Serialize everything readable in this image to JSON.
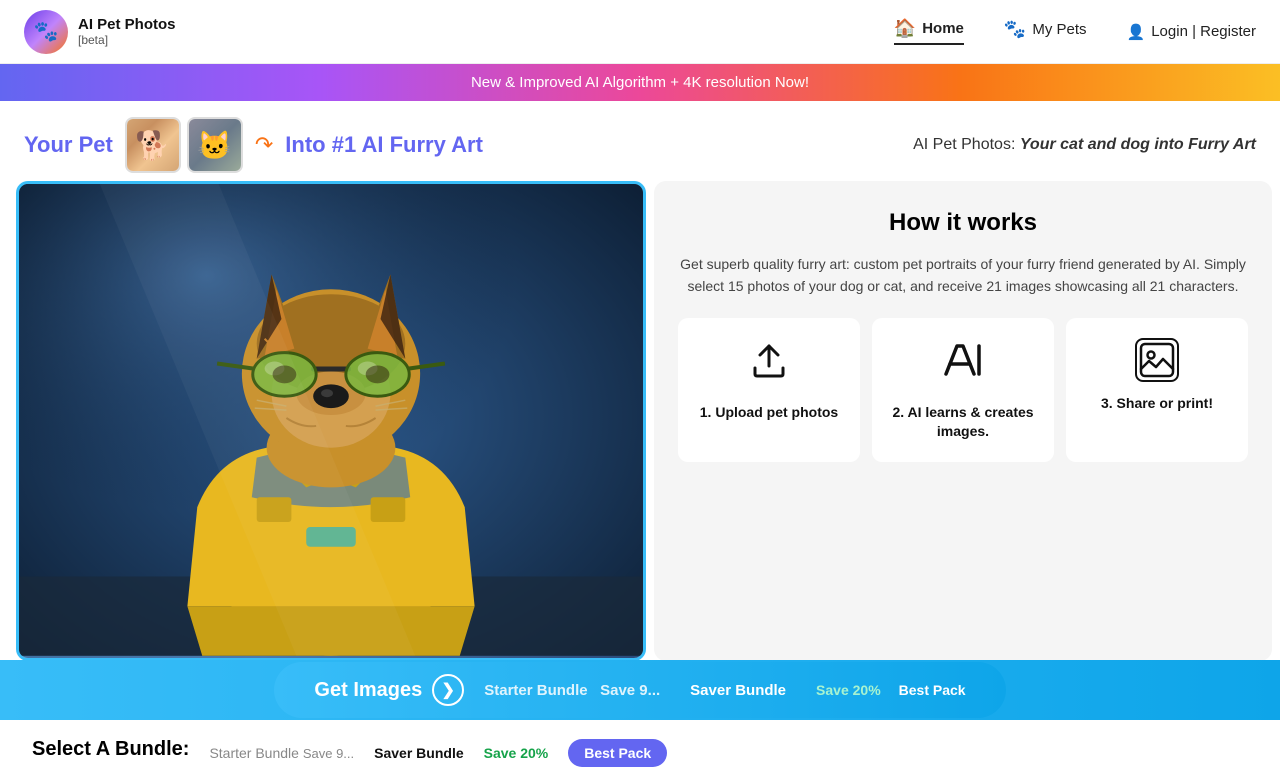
{
  "header": {
    "logo_title": "AI Pet Photos",
    "logo_beta": "[beta]",
    "logo_emoji": "🐾",
    "nav": [
      {
        "id": "home",
        "label": "Home",
        "active": true,
        "icon": "🏠"
      },
      {
        "id": "my-pets",
        "label": "My Pets",
        "active": false,
        "icon": "🐾"
      }
    ],
    "login_label": "Login | Register",
    "login_icon": "👤"
  },
  "banner": {
    "text": "New & Improved AI Algorithm + 4K resolution Now!"
  },
  "hero": {
    "your_pet_label": "Your Pet",
    "arrow": "↷",
    "into_label": "Into #1 AI Furry Art",
    "right_title": "AI Pet Photos:",
    "right_subtitle": "Your cat and dog into Furry Art"
  },
  "how_it_works": {
    "title": "How it works",
    "description": "Get superb quality furry art: custom pet portraits of your furry friend generated by AI. Simply select 15 photos of your dog or cat, and receive 21 images showcasing all 21 characters.",
    "steps": [
      {
        "id": "upload",
        "icon_type": "upload",
        "label": "1. Upload pet photos"
      },
      {
        "id": "ai",
        "icon_type": "ai-text",
        "label": "2. AI learns & creates images."
      },
      {
        "id": "share",
        "icon_type": "image-frame",
        "label": "3. Share or print!"
      }
    ]
  },
  "bundle": {
    "title": "Select A Bundle:",
    "tabs": [
      {
        "id": "starter",
        "label": "Starter Bundle",
        "save": "Save 9..."
      },
      {
        "id": "saver",
        "label": "Saver Bundle",
        "active": false
      },
      {
        "id": "best",
        "label": "Best Pack",
        "save_label": "Save 20%",
        "highlight": true
      }
    ]
  },
  "cta": {
    "label": "Get Images",
    "arrow": "❯"
  }
}
